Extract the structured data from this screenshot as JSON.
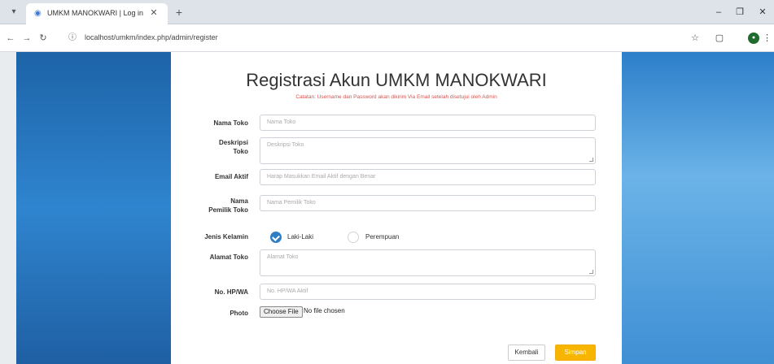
{
  "browser": {
    "tab_title": "UMKM MANOKWARI | Log in",
    "url": "localhost/umkm/index.php/admin/register"
  },
  "page": {
    "title": "Registrasi Akun UMKM MANOKWARI",
    "subtitle": "Catatan: Username dan Password akan dikirim Via Email setelah disetujui oleh Admin"
  },
  "form": {
    "nama_toko": {
      "label": "Nama Toko",
      "placeholder": "Nama Toko"
    },
    "deskripsi": {
      "label": "Deskripsi Toko",
      "placeholder": "Deskripsi Toko"
    },
    "email": {
      "label": "Email Aktif",
      "placeholder": "Harap Masukkan Email Aktif dengan Benar"
    },
    "nama_pemilik": {
      "label": "Nama Pemilik Toko",
      "placeholder": "Nama Pemilik Toko"
    },
    "jenis_kelamin": {
      "label": "Jenis Kelamin",
      "options": [
        "Laki-Laki",
        "Perempuan"
      ],
      "selected": "Laki-Laki"
    },
    "alamat": {
      "label": "Alamat Toko",
      "placeholder": "Alamat Toko"
    },
    "no_hp": {
      "label": "No. HP/WA",
      "placeholder": "No. HP/WA Aktif"
    },
    "photo": {
      "label": "Photo",
      "button": "Choose File",
      "status": "No file chosen"
    }
  },
  "buttons": {
    "back": "Kembali",
    "save": "Simpan"
  },
  "colors": {
    "accent": "#2e7ec4",
    "save": "#f7b500",
    "note": "#d9534f"
  }
}
